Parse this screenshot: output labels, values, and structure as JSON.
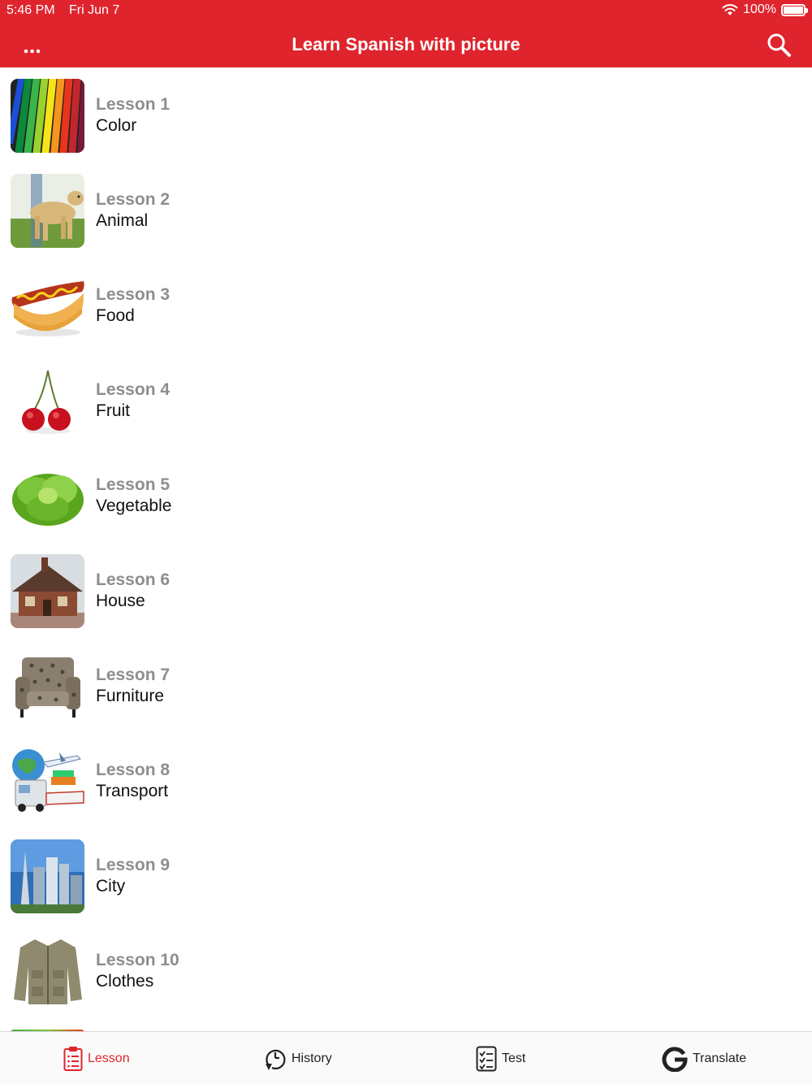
{
  "status_bar": {
    "time": "5:46 PM",
    "date": "Fri Jun 7",
    "battery_percent": "100%",
    "battery_level": 1.0
  },
  "header": {
    "title": "Learn Spanish with picture",
    "more_icon": "more-dots-icon",
    "search_icon": "search-icon"
  },
  "lessons": [
    {
      "number": "Lesson 1",
      "name": "Color",
      "image": "colored-pencils-image"
    },
    {
      "number": "Lesson 2",
      "name": "Animal",
      "image": "dog-image"
    },
    {
      "number": "Lesson 3",
      "name": "Food",
      "image": "hotdog-image"
    },
    {
      "number": "Lesson 4",
      "name": "Fruit",
      "image": "cherries-image"
    },
    {
      "number": "Lesson 5",
      "name": "Vegetable",
      "image": "lettuce-image"
    },
    {
      "number": "Lesson 6",
      "name": "House",
      "image": "house-image"
    },
    {
      "number": "Lesson 7",
      "name": "Furniture",
      "image": "armchair-image"
    },
    {
      "number": "Lesson 8",
      "name": "Transport",
      "image": "transport-image"
    },
    {
      "number": "Lesson 9",
      "name": "City",
      "image": "city-image"
    },
    {
      "number": "Lesson 10",
      "name": "Clothes",
      "image": "jacket-image"
    }
  ],
  "tabs": [
    {
      "label": "Lesson",
      "icon": "clipboard-list-icon",
      "active": true
    },
    {
      "label": "History",
      "icon": "history-clock-icon",
      "active": false
    },
    {
      "label": "Test",
      "icon": "checklist-icon",
      "active": false
    },
    {
      "label": "Translate",
      "icon": "google-g-icon",
      "active": false
    }
  ],
  "colors": {
    "accent": "#e0242d",
    "lesson_number": "#8e8e8e",
    "lesson_name": "#111111"
  }
}
